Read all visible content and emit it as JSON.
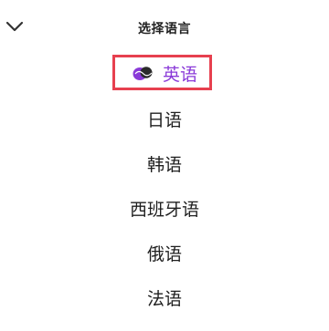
{
  "header": {
    "title": "选择语言",
    "back_icon": "chevron-down-icon"
  },
  "languages": [
    {
      "label": "英语",
      "selected": true
    },
    {
      "label": "日语",
      "selected": false
    },
    {
      "label": "韩语",
      "selected": false
    },
    {
      "label": "西班牙语",
      "selected": false
    },
    {
      "label": "俄语",
      "selected": false
    },
    {
      "label": "法语",
      "selected": false
    }
  ],
  "selected_icon": "checkmark-heart-icon",
  "colors": {
    "accent": "#8a3ad8",
    "highlight_box": "#e7404f",
    "text": "#1f1f1f"
  }
}
